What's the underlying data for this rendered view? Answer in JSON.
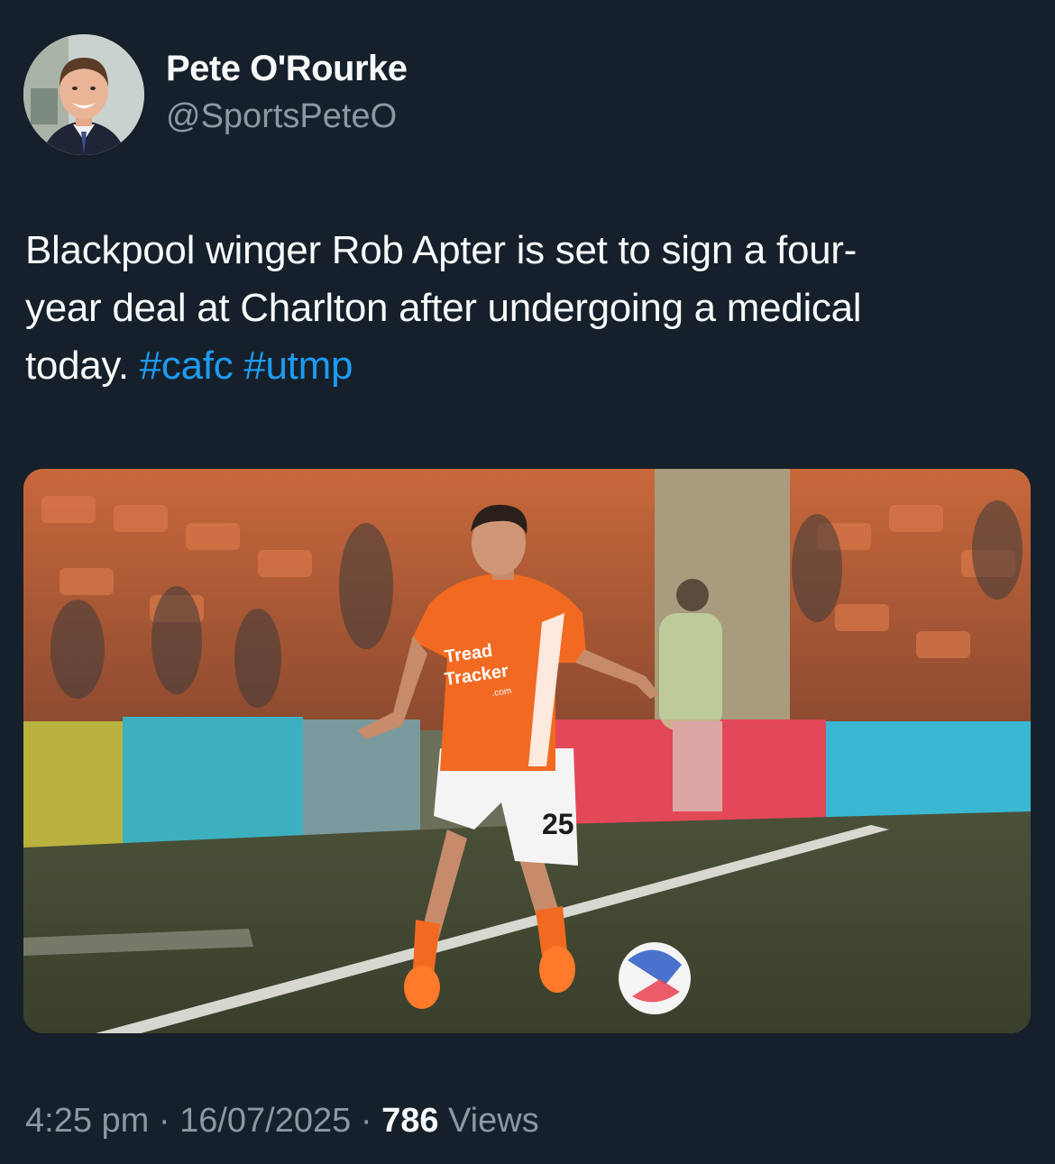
{
  "author": {
    "display_name": "Pete O'Rourke",
    "handle": "@SportsPeteO"
  },
  "tweet": {
    "text_line1": "Blackpool winger Rob Apter is set to sign a four-",
    "text_line2": "year deal at Charlton after undergoing a medical",
    "text_line3_prefix": "today. ",
    "hashtags": [
      "#cafc",
      "#utmp"
    ]
  },
  "media": {
    "sponsor_line1": "Tread",
    "sponsor_line2": "Tracker",
    "sponsor_sub": ".com",
    "shirt_number": "25"
  },
  "meta": {
    "time": "4:25 pm",
    "separator": " · ",
    "date": "16/07/2025",
    "views_count": "786",
    "views_label": " Views"
  },
  "colors": {
    "background": "#15202b",
    "text_primary": "#f7f9f9",
    "text_secondary": "#8b98a5",
    "link": "#1d9bf0",
    "kit_orange": "#f26a21"
  }
}
